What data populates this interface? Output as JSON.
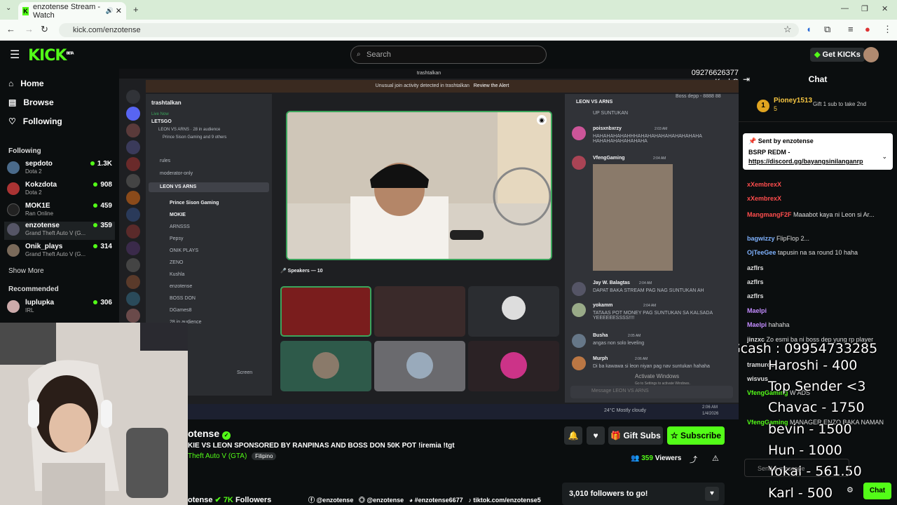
{
  "browser": {
    "tab_title": "enzotense Stream - Watch",
    "url": "kick.com/enzotense"
  },
  "header": {
    "logo": "KICK",
    "logo_badge": "BETA",
    "search_placeholder": "Search",
    "get_kicks": "Get KICKs",
    "phone_overlay": "09276626377",
    "phone_overlay_name": "KashG"
  },
  "sidebar": {
    "nav": [
      {
        "label": "Home",
        "icon": "home-icon"
      },
      {
        "label": "Browse",
        "icon": "browse-icon"
      },
      {
        "label": "Following",
        "icon": "heart-icon"
      }
    ],
    "following_heading": "Following",
    "following": [
      {
        "name": "sepdoto",
        "game": "Dota 2",
        "viewers": "1.3K"
      },
      {
        "name": "Kokzdota",
        "game": "Dota 2",
        "viewers": "908"
      },
      {
        "name": "MOK1E",
        "game": "Ran Online",
        "viewers": "459"
      },
      {
        "name": "enzotense",
        "game": "Grand Theft Auto V (G...",
        "viewers": "359"
      },
      {
        "name": "Onik_plays",
        "game": "Grand Theft Auto V (G...",
        "viewers": "314"
      }
    ],
    "show_more": "Show More",
    "recommended_heading": "Recommended",
    "recommended": [
      {
        "name": "luplupka",
        "game": "IRL",
        "viewers": "306"
      }
    ]
  },
  "stream": {
    "discord": {
      "window_title": "trashtalkan",
      "alert": "Unusual join activity detected in trashtalkan",
      "alert_action": "Review the Alert",
      "server_name": "trashtalkan",
      "live_now": "Live Now",
      "live_title": "LETSGO",
      "live_sub": "LEON VS ARNS · 28 in audience",
      "live_sub2": "Prince Sison Gaming and 9 others",
      "channels": [
        "rules",
        "moderator-only",
        "LEON VS ARNS"
      ],
      "members": [
        "Prince Sison Gaming",
        "MOKIE",
        "ARNSSS",
        "Pepsy",
        "ONIK PLAYS",
        "ZENO",
        "Kushla",
        "enzotense",
        "BOSS DON",
        "DGames8"
      ],
      "in_audience": "28 in audience",
      "speakers": "Speakers — 10",
      "screen": "Screen",
      "chat_channel": "LEON VS ARNS",
      "chat_top": "UP SUNTUKAN",
      "chat_msgs": [
        {
          "user": "poisxnbxrzy",
          "time": "2:03 AM",
          "text": "HAHAHAHAHAHHHAHAHAHAHAHAHAHAHAHA HAHAHAHAHAHAHAHA"
        },
        {
          "user": "VfengGaming",
          "time": "2:04 AM",
          "text": ""
        },
        {
          "user": "Jay W. Balagtas",
          "time": "2:04 AM",
          "text": "DAPAT BAKA STREAM PAG NAG SUNTUKAN AH"
        },
        {
          "user": "yokamm",
          "time": "2:04 AM",
          "text": "TATAAS POT MONEY PAG SUNTUKAN SA KALSADA YEEEEEESSSS!!!!"
        },
        {
          "user": "Busha",
          "time": "2:05 AM",
          "text": "angas non solo leveling"
        },
        {
          "user": "Murph",
          "time": "2:06 AM",
          "text": "Di ba kawawa si leon niyan pag nav suntukan hahaha"
        }
      ],
      "message_placeholder": "Message LEON VS ARNS",
      "activate": "Activate Windows",
      "activate_sub": "Go to Settings to activate Windows.",
      "weather": "24°C Mostly cloudy",
      "clock": "2:06 AM",
      "date": "1/4/2026",
      "boss_dapp": "Boss depp - 8888 88"
    }
  },
  "info": {
    "streamer": "enzotense",
    "streamer_visible": "otense",
    "title": "KIE VS LEON SPONSORED BY RANPINAS AND BOSS DON 50K POT !iremia !tgt",
    "category": "Theft Auto V (GTA)",
    "language": "Filipino",
    "viewers": "359",
    "viewers_label": "Viewers",
    "gift_subs": "Gift Subs",
    "subscribe": "Subscribe",
    "followers": "7K",
    "followers_label": "Followers",
    "socials": [
      "@enzotense",
      "@enzotense",
      "#enzotense6677",
      "tiktok.com/enzotense5"
    ],
    "goal": "3,010 followers to go!"
  },
  "chat": {
    "heading": "Chat",
    "top_gifter": "Pioney1513",
    "top_gifter_count": "5",
    "gift_prompt": "Gift 1 sub to take 2nd",
    "pinned_by": "Sent by",
    "pinned_user": "enzotense",
    "pinned_text": "BSRP REDM -",
    "pinned_link": "https://discord.gg/bayangsinilanganrp",
    "messages": [
      {
        "user": "xXembrexX",
        "text": "",
        "color": "#ff4d4d"
      },
      {
        "user": "xXembrexX",
        "text": "",
        "color": "#ff4d4d"
      },
      {
        "user": "MangmangF2F",
        "text": "Maaabot kaya ni Leon si Ar...",
        "color": "#ff4d4d"
      },
      {
        "user": "bagwizzy",
        "text": "FlipFlop 2...",
        "color": "#7fb2ff"
      },
      {
        "user": "OjTeeGee",
        "text": "tapusin na sa round 10 haha",
        "color": "#7fb2ff"
      },
      {
        "user": "azflrs",
        "text": "",
        "color": "#ffffff"
      },
      {
        "user": "azflrs",
        "text": "",
        "color": "#ffffff"
      },
      {
        "user": "azflrs",
        "text": "",
        "color": "#ffffff"
      },
      {
        "user": "Maelpi",
        "text": "",
        "color": "#c38cff"
      },
      {
        "user": "Maelpi",
        "text": "hahaha",
        "color": "#c38cff"
      },
      {
        "user": "jinzxc",
        "text": "Zo esmi ba ni boss dep yung rp player",
        "color": "#ffffff"
      },
      {
        "user": "tramuros",
        "text": "",
        "color": "#ffffff"
      },
      {
        "user": "wisvus",
        "text": "",
        "color": "#ffffff"
      },
      {
        "user": "VfengGaming",
        "text": "W ADS",
        "color": "#53fc18"
      },
      {
        "user": "",
        "text": "",
        "color": "#ffffff"
      },
      {
        "user": "VfengGaming",
        "text": "MANAGER ENZO BAKA NAMAN",
        "color": "#53fc18"
      }
    ],
    "overlay_gcash": "Gcash : 09954733285",
    "overlay_leaders": [
      "Haroshi - 400",
      "Top Sender <3",
      "Chavac - 1750",
      "bevin - 1500",
      "Hun - 1000",
      "Yokai - 561.50",
      "Karl - 500"
    ],
    "chat_button": "Chat",
    "send_placeholder": "Send a message"
  },
  "colors": {
    "accent": "#53fc18",
    "bg": "#0b0e0f",
    "discord_bg": "#1e1f22"
  }
}
